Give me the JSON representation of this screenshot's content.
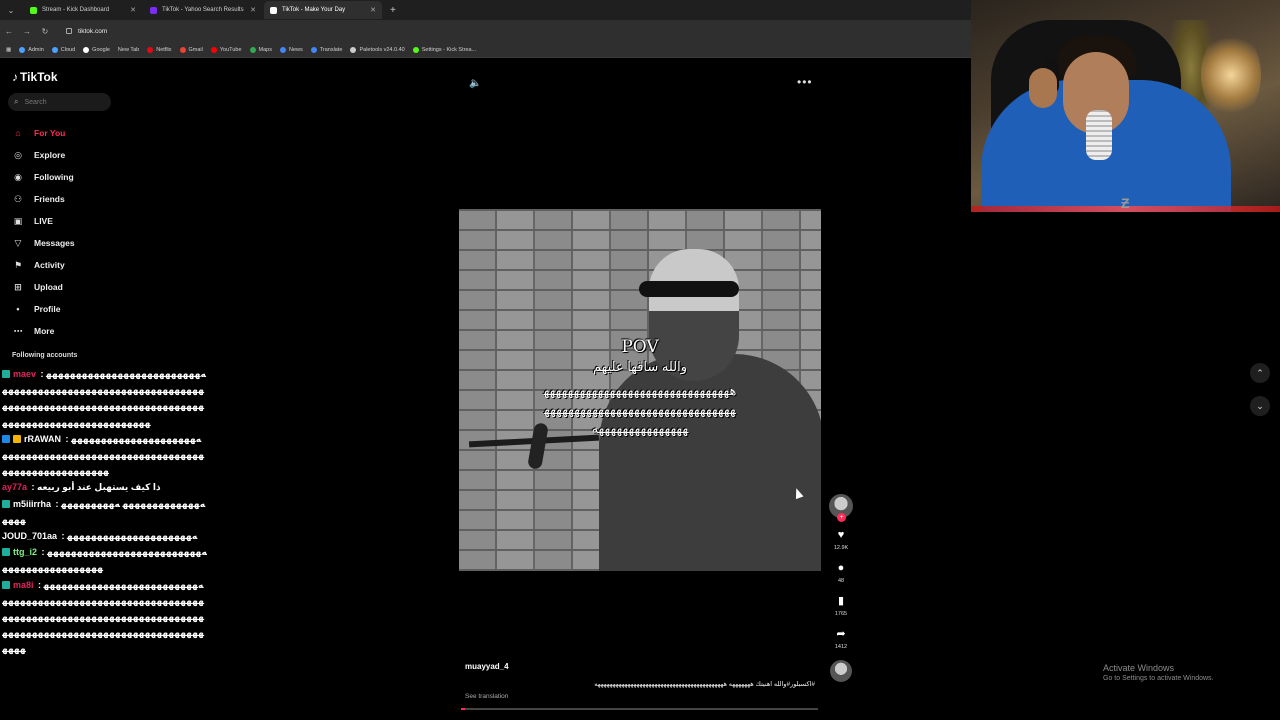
{
  "browser": {
    "tabs": [
      {
        "title": "Stream - Kick Dashboard",
        "color": "#53fc18"
      },
      {
        "title": "TikTok - Yahoo Search Results",
        "color": "#7b2cf5"
      },
      {
        "title": "TikTok - Make Your Day",
        "color": "#ffffff"
      }
    ],
    "url": "tiktok.com",
    "bookmarks": [
      "Admin",
      "Cloud",
      "Google",
      "New Tab",
      "Netflix",
      "Gmail",
      "YouTube",
      "Maps",
      "News",
      "Translate",
      "Paletools v24.0.40",
      "Settings - Kick Strea..."
    ]
  },
  "tiktok": {
    "logo": "TikTok",
    "search_placeholder": "Search",
    "menu": [
      "For You",
      "Explore",
      "Following",
      "Friends",
      "LIVE",
      "Messages",
      "Activity",
      "Upload",
      "Profile",
      "More"
    ],
    "following_title": "Following accounts"
  },
  "chat": [
    {
      "user": "maev",
      "color": "#e0245e",
      "msg": "ﻪﻬﻬﻬﻬﻬﻬﻬﻬﻬﻬﻬﻬﻬﻬﻬﻬﻬﻬﻬﻬﻬﻬﻬﻬﻬﻬﻬﻬﻬﻬﻬﻬﻬﻬﻬﻬﻬﻬﻬﻬﻬﻬﻬﻬﻬﻬﻬﻬﻬﻬﻬﻬﻬﻬﻬﻬﻬﻬﻬﻬﻬﻬﻬﻬﻬﻬﻬﻬﻬﻬﻬﻬﻬﻬﻬﻬﻬﻬﻬﻬﻬﻬﻬﻬﻬﻬﻬﻬﻬﻬﻬﻬﻬﻬﻬﻬﻬﻬﻬﻬﻬﻬﻬﻬﻬﻬﻬﻬﻬﻬﻬﻬﻬﻬﻬﻬﻬﻬﻬ"
    },
    {
      "user": "rRAWAN",
      "color": "#ffffff",
      "msg": "ﻪﻬﻬﻬﻬﻬﻬﻬﻬﻬﻬﻬﻬﻬﻬﻬﻬﻬﻬﻬﻬﻬﻬﻬﻬﻬﻬﻬﻬﻬﻬﻬﻬﻬﻬﻬﻬﻬﻬﻬﻬﻬﻬﻬﻬﻬﻬﻬﻬﻬﻬﻬﻬﻬﻬﻬﻬﻬﻬﻬﻬﻬﻬﻬﻬﻬﻬﻬﻬﻬﻬﻬﻬﻬ"
    },
    {
      "user": "ay77a",
      "color": "#e0245e",
      "msg": "ذا كيف يستهبل عند أبو ربيعه"
    },
    {
      "user": "m5iiirrha",
      "color": "#ffffff",
      "msg": "ﻪﻬﻬﻬﻬﻬﻬﻬﻬﻬﻬﻬﻬﻬ ﻪﻬﻬﻬﻬﻬﻬﻬﻬﻬﻬﻬﻬﻬ"
    },
    {
      "user": "JOUD_701aa",
      "color": "#ffffff",
      "msg": "ﻪﻬﻬﻬﻬﻬﻬﻬﻬﻬﻬﻬﻬﻬﻬﻬﻬﻬﻬﻬﻬﻬ"
    },
    {
      "user": "ttg_i2",
      "color": "#7cf27c",
      "msg": "ﻪﻬﻬﻬﻬﻬﻬﻬﻬﻬﻬﻬﻬﻬﻬﻬﻬﻬﻬﻬﻬﻬﻬﻬﻬﻬﻬﻬﻬﻬﻬﻬﻬﻬﻬﻬﻬﻬﻬﻬﻬﻬﻬﻬ"
    },
    {
      "user": "ma8i",
      "color": "#e0245e",
      "msg": "ﻪﻬﻬﻬﻬﻬﻬﻬﻬﻬﻬﻬﻬﻬﻬﻬﻬﻬﻬﻬﻬﻬﻬﻬﻬﻬﻬﻬﻬﻬﻬﻬﻬﻬﻬﻬﻬﻬﻬﻬﻬﻬﻬﻬﻬﻬﻬﻬﻬﻬﻬﻬﻬﻬﻬﻬﻬﻬﻬﻬﻬﻬﻬﻬﻬﻬﻬﻬﻬﻬﻬﻬﻬﻬﻬﻬﻬﻬﻬﻬﻬﻬﻬﻬﻬﻬﻬﻬﻬﻬﻬﻬﻬﻬﻬﻬﻬﻬﻬﻬﻬﻬﻬﻬﻬﻬﻬﻬﻬﻬﻬﻬﻬﻬﻬﻬﻬﻬﻬﻬﻬﻬﻬﻬﻬﻬﻬﻬﻬﻬﻬﻬﻬ"
    }
  ],
  "video": {
    "caption_pov": "POV",
    "caption_ar": "والله ساقها عليهم",
    "caption_ha": "هههههههههههههههههههههههههههههههههههههههههههههههههههههههههههههههههههههههههههههههه",
    "likes": "12.9K",
    "comments": "48",
    "saves": "1765",
    "shares": "1412",
    "author": "muayyad_4",
    "description": "#اكسبلور#والله اهنيتك هههههههه هههههههههههههههههههههههههههههههههههههههههههه",
    "see_translation": "See translation",
    "progress": 0.01
  },
  "system": {
    "activate_title": "Activate Windows",
    "activate_sub": "Go to Settings to activate Windows."
  }
}
